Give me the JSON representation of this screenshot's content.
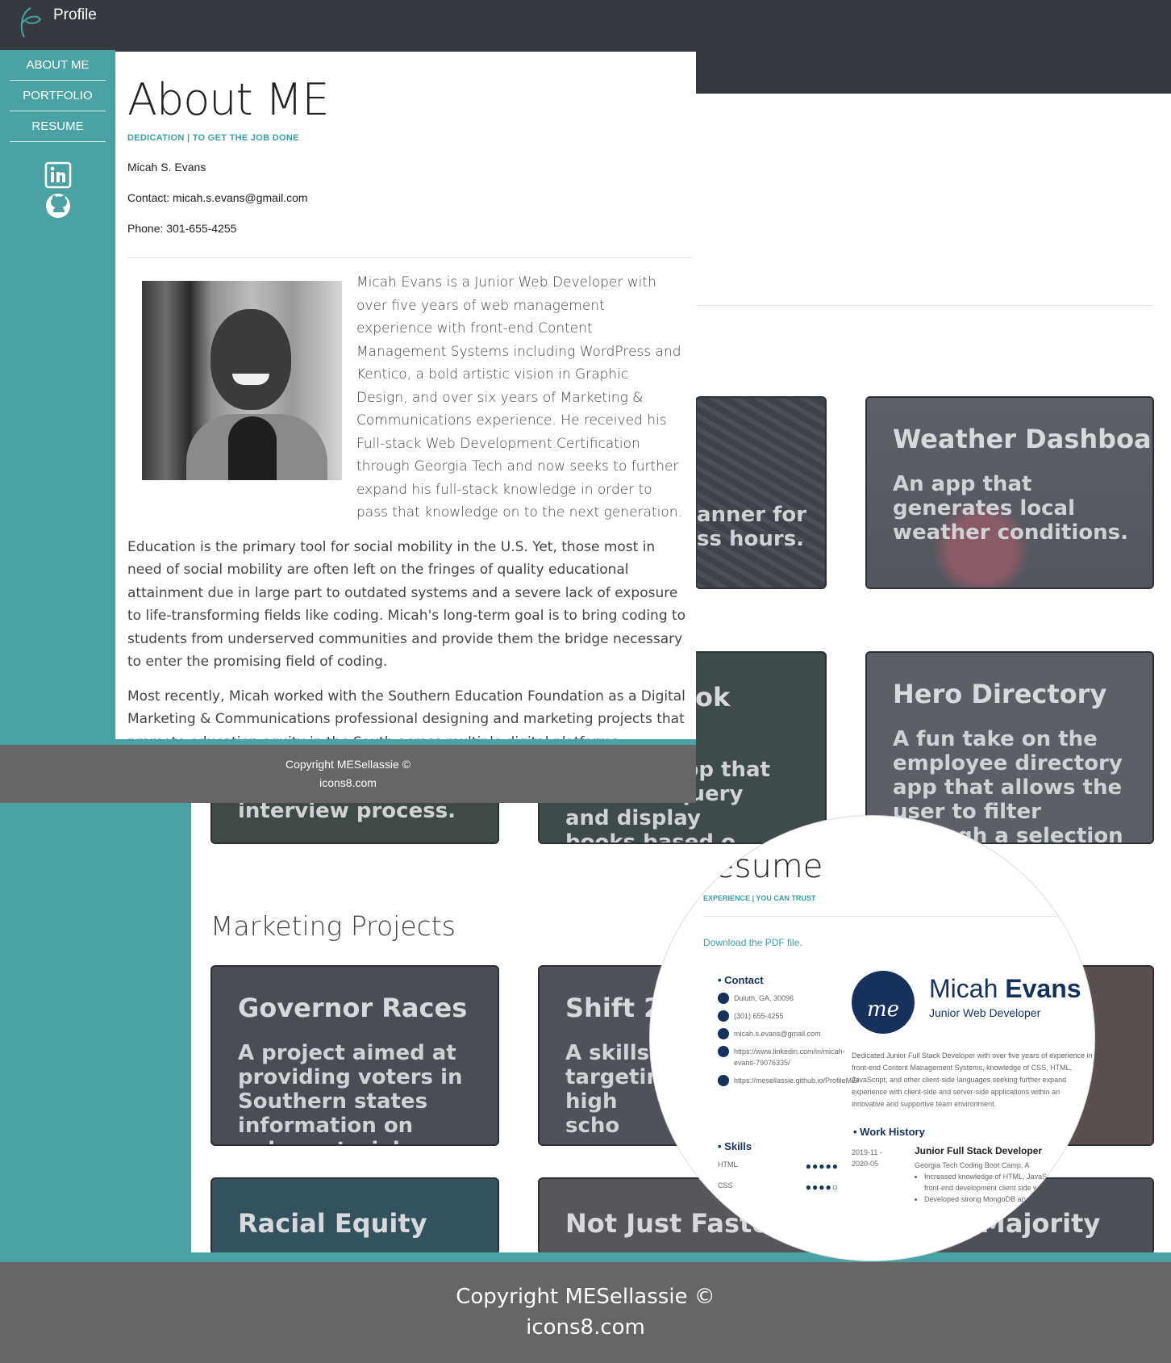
{
  "brand": {
    "title": "Profile"
  },
  "nav": {
    "items": [
      "ABOUT ME",
      "PORTFOLIO",
      "RESUME"
    ]
  },
  "social": {
    "linkedin": "linkedin-icon",
    "github": "github-icon"
  },
  "about": {
    "title": "About ME",
    "subtitle": "DEDICATION | TO GET THE JOB DONE",
    "name": "Micah S. Evans",
    "contact": "Contact: micah.s.evans@gmail.com",
    "phone": "Phone: 301-655-4255",
    "bio": "Micah Evans is a Junior Web Developer with over five years of web management experience with front-end Content Management Systems including WordPress and Kentico, a bold artistic vision in Graphic Design, and over six years of Marketing & Communications experience. He received his Full-stack Web Development Certification through Georgia Tech and now seeks to further expand his full-stack knowledge in order to pass that knowledge on to the next generation.",
    "paragraph1": "Education is the primary tool for social mobility in the U.S. Yet, those most in need of social mobility are often left on the fringes of quality educational attainment due in large part to outdated systems and a severe lack of exposure to life-transforming fields like coding. Micah's long-term goal is to bring coding to students from underserved communities and provide them the bridge necessary to enter the promising field of coding.",
    "paragraph2": "Most recently, Micah worked with the Southern Education Foundation as a Digital Marketing & Communications professional designing and marketing projects that promote education equity in the South across multiple digital platforms.",
    "footer_line1": "Copyright MESellassie ©",
    "footer_line2": "icons8.com"
  },
  "portfolio": {
    "cards": [
      {
        "title": "",
        "desc": "anner for ss hours."
      },
      {
        "title": "Weather Dashboard",
        "desc": "An app that generates local weather conditions."
      },
      {
        "title": "",
        "desc": "interview process."
      },
      {
        "title": "ok",
        "desc": "l Google app that works to query and display books based o"
      },
      {
        "title": "Hero Directory",
        "desc": "A fun take on the employee directory app that allows the user to filter through a selection ...loyees."
      }
    ],
    "marketing_heading": "Marketing Projects",
    "marketing_cards": [
      {
        "title": "Governor Races",
        "desc": "A project aimed at providing voters in Southern states information on gubernatorial"
      },
      {
        "title": "Shift 2 S",
        "desc": "A skills tr targeting high scho young adul of Alabama"
      },
      {
        "title": "",
        "desc": ""
      },
      {
        "title": "Racial Equity",
        "desc": ""
      },
      {
        "title": "Not Just Faster",
        "desc": ""
      },
      {
        "title": "Majority",
        "desc": ""
      }
    ]
  },
  "resume": {
    "title": "esume",
    "subtitle": "EXPERIENCE | YOU CAN TRUST",
    "download": "Download the PDF file.",
    "contact_heading": "Contact",
    "contact": [
      "Duluth, GA, 30096",
      "(301) 655-4255",
      "micah.s.evans@gmail.com",
      "https://www.linkedin.com/in/micah-evans-79076335/",
      "https://mesellassie.github.io/ProfileME/"
    ],
    "skills_heading": "Skills",
    "skills": [
      {
        "name": "HTML",
        "dots": "●●●●●"
      },
      {
        "name": "CSS",
        "dots": "●●●●○"
      }
    ],
    "avatar": "me",
    "name_first": "Micah ",
    "name_last": "Evans",
    "role": "Junior Web Developer",
    "summary": "Dedicated Junior Full Stack Developer with over five years of experience in front-end Content Management Systems, knowledge of CSS, HTML, JavaScript, and other client-side languages seeking further expand experience with client-side and server-side applications within an innovative and supportive team environment.",
    "work_heading": "Work History",
    "dates": "2019-11 - 2020-05",
    "job_title": "Junior Full Stack Developer",
    "job_org": "Georgia Tech Coding Boot Camp, A",
    "bullets": [
      "Increased knowledge of HTML, JavaScript front-end development client side webpage d",
      "Developed strong MongoDB ap"
    ]
  },
  "page_footer": {
    "line1": "Copyright MESellassie ©",
    "line2": "icons8.com"
  },
  "colors": {
    "teal": "#4aa3a2",
    "dark": "#343a40",
    "footer": "#666666",
    "navy": "#16325c"
  }
}
